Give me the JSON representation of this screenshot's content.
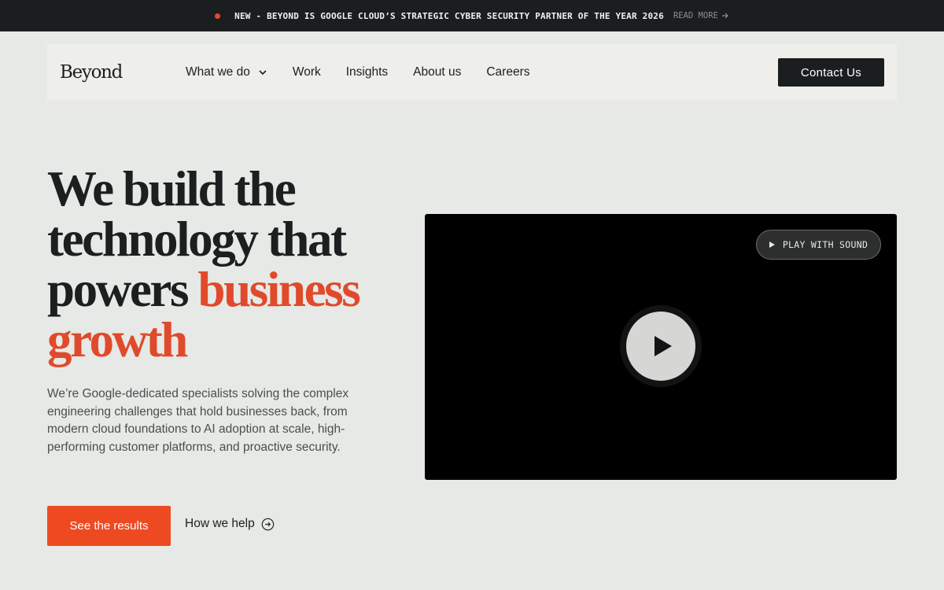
{
  "announcement": {
    "text": "NEW - BEYOND IS GOOGLE CLOUD’S STRATEGIC CYBER SECURITY PARTNER OF THE YEAR 2026",
    "link_label": "READ MORE",
    "dot_color": "#e8492c"
  },
  "nav": {
    "logo": "Beyond",
    "items": [
      {
        "label": "What we do",
        "has_dropdown": true
      },
      {
        "label": "Work"
      },
      {
        "label": "Insights"
      },
      {
        "label": "About us"
      },
      {
        "label": "Careers"
      }
    ],
    "contact_label": "Contact Us"
  },
  "hero": {
    "headline_plain": "We build the technology that powers",
    "headline_accent": "business growth",
    "accent_color": "#e04a2c",
    "description": "We’re Google-dedicated specialists solving the complex engineering challenges that hold businesses back, from modern cloud foundations to AI adoption at scale, high-performing customer platforms, and proactive security.",
    "primary_cta": "See the results",
    "secondary_cta": "How we help",
    "primary_cta_color": "#ee4a22"
  },
  "video": {
    "sound_button_label": "PLAY WITH SOUND",
    "play_icon": "play-icon"
  }
}
